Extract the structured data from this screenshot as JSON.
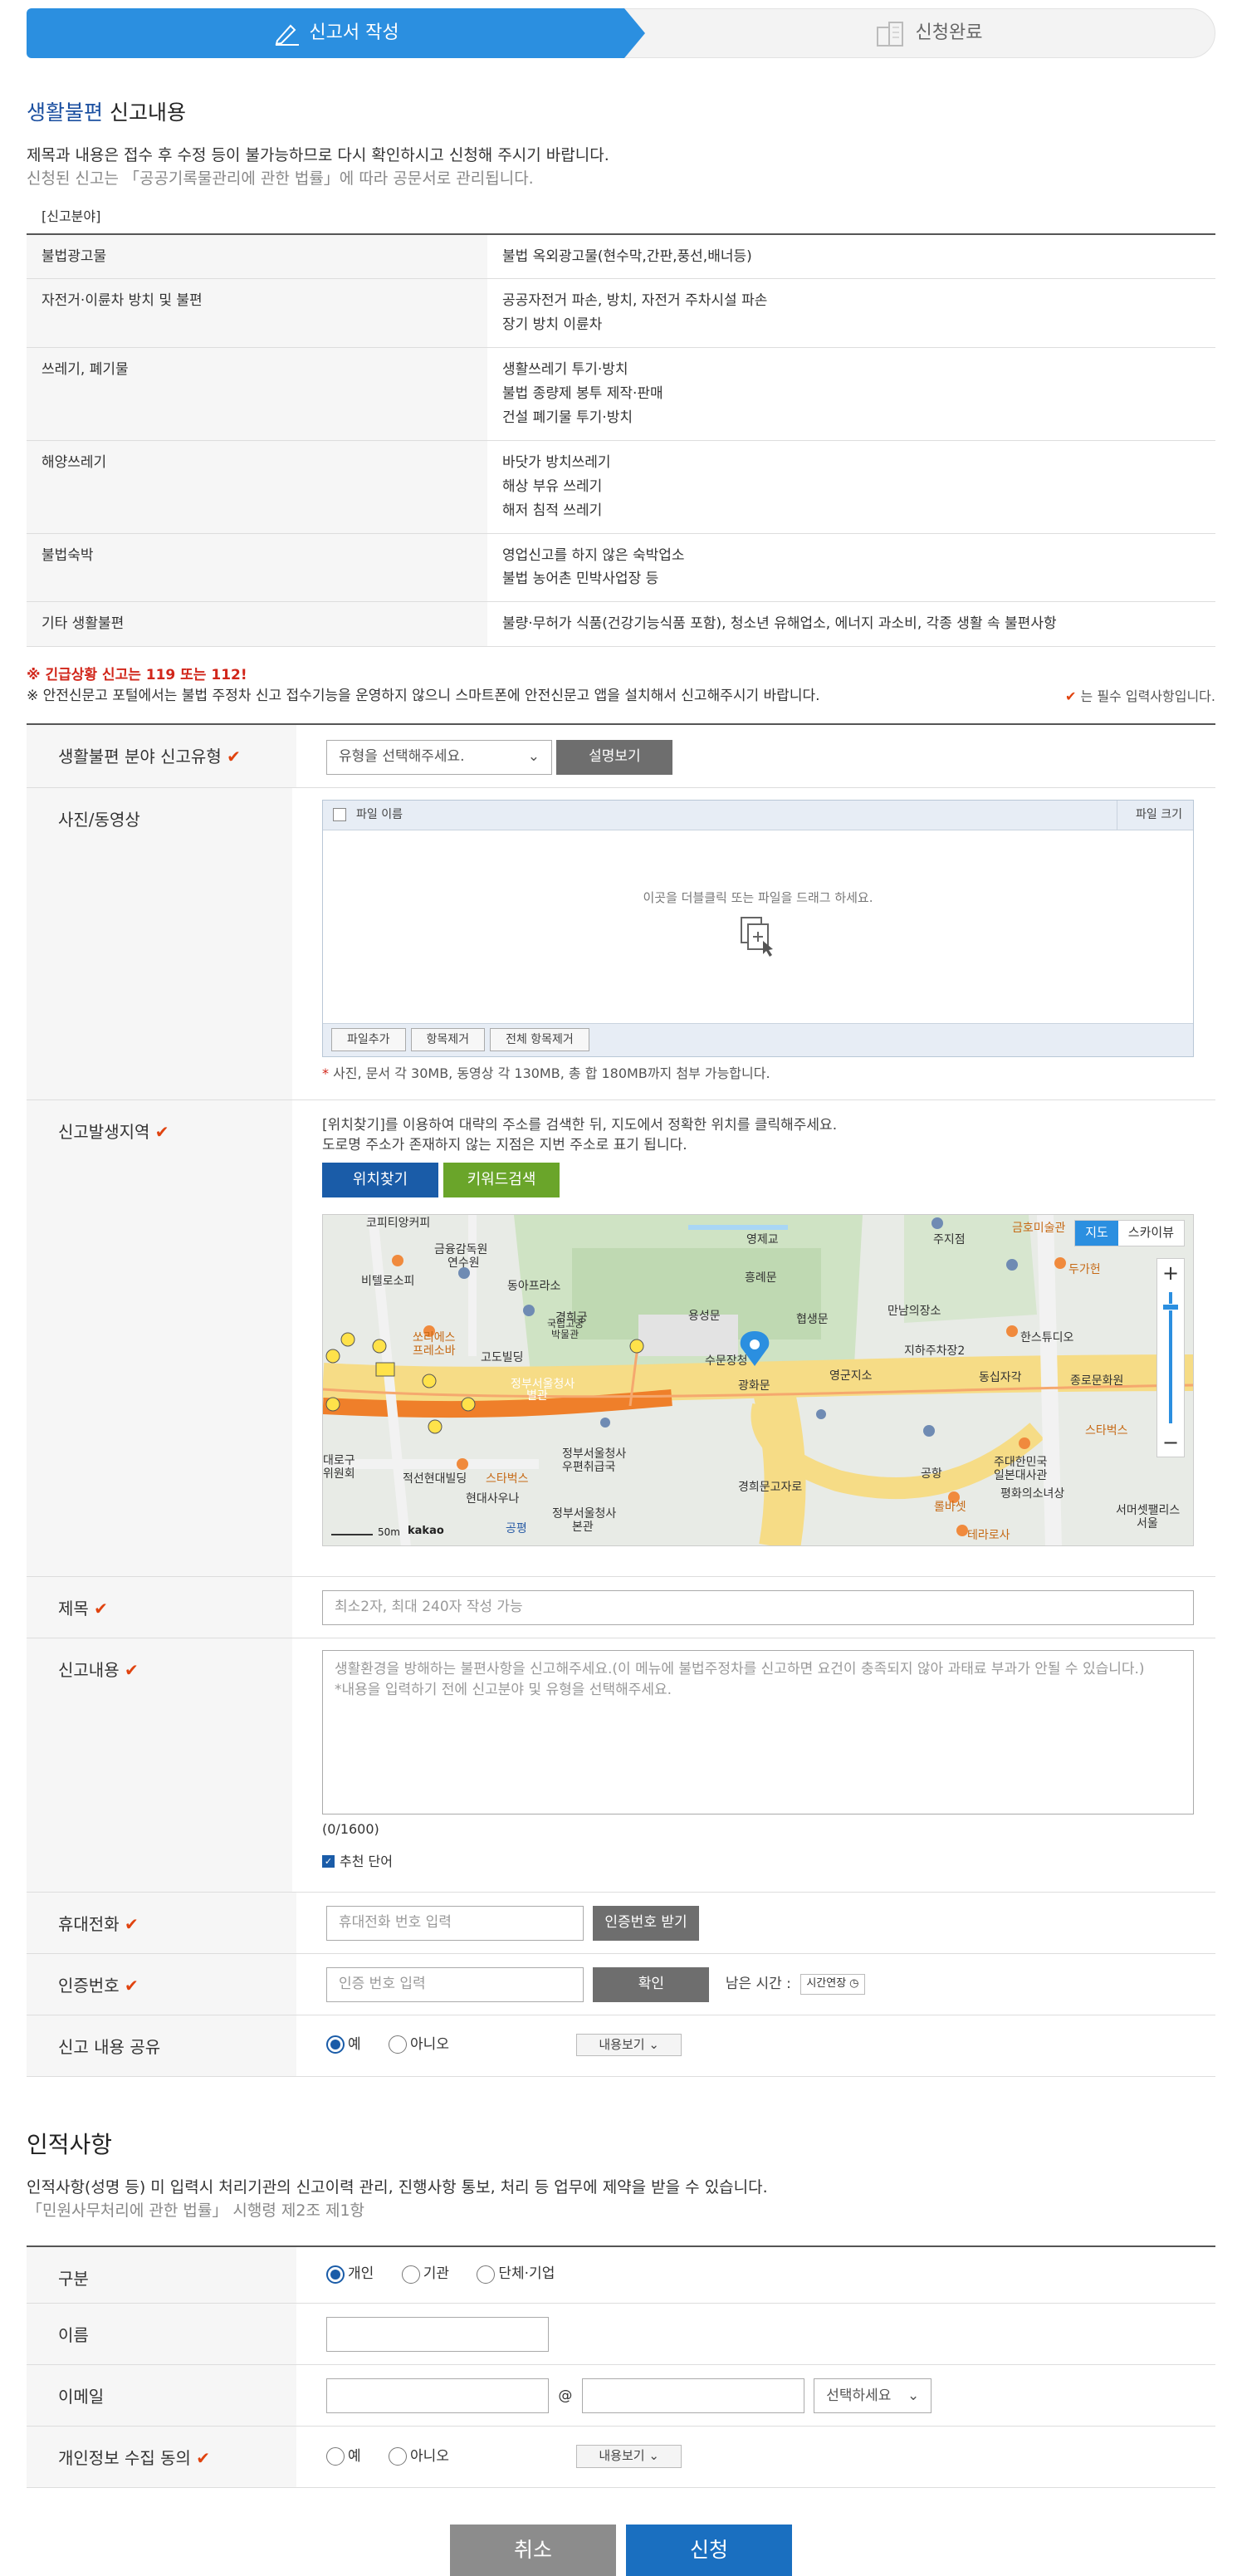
{
  "steps": {
    "step1": "신고서 작성",
    "step2": "신청완료"
  },
  "section_title": {
    "bold": "생활불편",
    "rest": " 신고내용"
  },
  "intro": {
    "line1": "제목과 내용은 접수 후 수정 등이 불가능하므로 다시 확인하시고 신청해 주시기 바랍니다.",
    "line2": "신청된 신고는 「공공기록물관리에 관한 법률」에 따라 공문서로 관리됩니다."
  },
  "category_caption": "[신고분야]",
  "categories": [
    {
      "name": "불법광고물",
      "desc": [
        "불법 옥외광고물(현수막,간판,풍선,배너등)"
      ]
    },
    {
      "name": "자전거·이륜차 방치 및 불편",
      "desc": [
        "공공자전거 파손, 방치, 자전거 주차시설 파손",
        "장기 방치 이륜차"
      ]
    },
    {
      "name": "쓰레기, 폐기물",
      "desc": [
        "생활쓰레기 투기·방치",
        "불법 종량제 봉투 제작·판매",
        "건설 폐기물 투기·방치"
      ]
    },
    {
      "name": "해양쓰레기",
      "desc": [
        "바닷가 방치쓰레기",
        "해상 부유 쓰레기",
        "해저 침적 쓰레기"
      ]
    },
    {
      "name": "불법숙박",
      "desc": [
        "영업신고를 하지 않은 숙박업소",
        "불법 농어촌 민박사업장 등"
      ]
    },
    {
      "name": "기타 생활불편",
      "desc": [
        "불량·무허가 식품(건강기능식품 포함), 청소년 유해업소, 에너지 과소비, 각종 생활 속 불편사항"
      ]
    }
  ],
  "notice": {
    "emergency": "※ 긴급상황 신고는 119 또는 112!",
    "app": "※ 안전신문고 포털에서는 불법 주정차 신고 접수기능을 운영하지 않으니 스마트폰에 안전신문고 앱을 설치해서 신고해주시기 바랍니다.",
    "required": "는 필수 입력사항입니다."
  },
  "form": {
    "type": {
      "label": "생활불편 분야 신고유형",
      "select": "유형을 선택해주세요.",
      "button": "설명보기"
    },
    "media": {
      "label": "사진/동영상",
      "col_name": "파일 이름",
      "col_size": "파일 크기",
      "drop_hint": "이곳을 더블클릭 또는 파일을 드래그 하세요.",
      "btn_add": "파일추가",
      "btn_remove": "항목제거",
      "btn_remove_all": "전체 항목제거",
      "help_star": "*",
      "help": " 사진,   문서 각 30MB, 동영상 각 130MB, 총 합 180MB까지 첨부 가능합니다."
    },
    "location": {
      "label": "신고발생지역",
      "help1": "[위치찾기]를 이용하여 대략의 주소를 검색한 뒤, 지도에서 정확한 위치를 클릭해주세요.",
      "help2": "도로명 주소가 존재하지 않는 지점은 지번 주소로 표기 됩니다.",
      "btn_find": "위치찾기",
      "btn_keyword": "키워드검색"
    },
    "title": {
      "label": "제목",
      "placeholder": "최소2자, 최대 240자 작성 가능"
    },
    "content": {
      "label": "신고내용",
      "placeholder1": "생활환경을 방해하는 불편사항을 신고해주세요.(이 메뉴에 불법주정차를 신고하면 요건이 충족되지 않아 과태료 부과가 안될 수 있습니다.)",
      "placeholder2": "*내용을 입력하기 전에 신고분야 및 유형을 선택해주세요.",
      "counter": "(0/1600)",
      "recommend": "추천 단어"
    },
    "phone": {
      "label": "휴대전화",
      "placeholder": "휴대전화 번호 입력",
      "button": "인증번호 받기"
    },
    "auth": {
      "label": "인증번호",
      "placeholder": "인증 번호 입력",
      "button": "확인",
      "remain": "남은 시간 :",
      "extend": "시간연장"
    },
    "share": {
      "label": "신고 내용 공유",
      "yes": "예",
      "no": "아니오",
      "view": "내용보기"
    }
  },
  "map": {
    "tab_map": "지도",
    "tab_sky": "스카이뷰",
    "zoom_in": "+",
    "zoom_out": "−",
    "scale": "50m",
    "brand": "kakao",
    "labels": [
      "코피티앙커피",
      "금융감독원 연수원",
      "비텔로소피",
      "동아프라소",
      "경희궁",
      "국립고궁 박물관",
      "고도빌딩",
      "용성문",
      "협생문",
      "만남의장소",
      "지하주차장2",
      "수문장청",
      "광화문",
      "영군지소",
      "동십자각",
      "종로문화원",
      "정부서울청사 별관",
      "쏘리에스 프레소바",
      "정부서울청사 우편취급국",
      "적선현대빌딩",
      "스타벅스",
      "현대사우나",
      "정부서울청사 본관",
      "경희문고자로",
      "주대한민국 일본대사관",
      "평화의소녀상",
      "스타벅스",
      "테라로사",
      "서머셋팰리스 서울",
      "흥례문",
      "영제교",
      "주지점",
      "금호미술관",
      "두가헌",
      "한스튜디오",
      "대로구 위원회",
      "공항",
      "롤바셋",
      "공평"
    ]
  },
  "privacy": {
    "title": "인적사항",
    "desc": "인적사항(성명 등) 미 입력시 처리기관의 신고이력 관리, 진행사항 통보, 처리 등 업무에 제약을 받을 수 있습니다.",
    "law": "「민원사무처리에 관한 법률」 시행령 제2조 제1항",
    "kind": {
      "label": "구분",
      "opt1": "개인",
      "opt2": "기관",
      "opt3": "단체·기업"
    },
    "name": {
      "label": "이름"
    },
    "email": {
      "label": "이메일",
      "at": "@",
      "select": "선택하세요"
    },
    "consent": {
      "label": "개인정보 수집 동의",
      "yes": "예",
      "no": "아니오",
      "view": "내용보기"
    }
  },
  "actions": {
    "cancel": "취소",
    "submit": "신청"
  },
  "colors": {
    "primary": "#1a5ca8",
    "step_active": "#2b8fe0",
    "required": "#e0430f",
    "emergency": "#d1261a"
  }
}
